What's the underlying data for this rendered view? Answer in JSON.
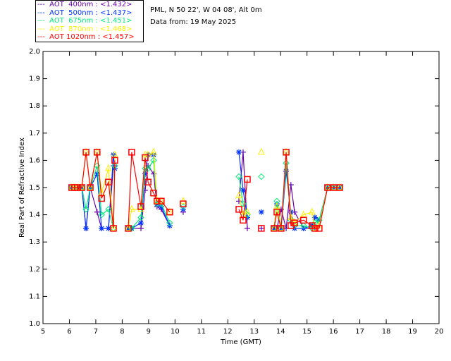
{
  "info": {
    "site": "PML, N 50 22', W 04 08', Alt 0m",
    "date": "Data from: 19 May 2025"
  },
  "chart_data": {
    "type": "line",
    "title": "",
    "xlabel": "Time (GMT)",
    "ylabel": "Real Part of Refractive Index",
    "xlim": [
      5,
      20
    ],
    "ylim": [
      1.0,
      2.0
    ],
    "xticks": [
      "5",
      "6",
      "7",
      "8",
      "9",
      "10",
      "11",
      "12",
      "13",
      "14",
      "15",
      "16",
      "17",
      "18",
      "19",
      "20"
    ],
    "yticks": [
      "1.0",
      "1.1",
      "1.2",
      "1.3",
      "1.4",
      "1.5",
      "1.6",
      "1.7",
      "1.8",
      "1.9",
      "2.0"
    ],
    "grid": false,
    "legend_position": "top-left, outside",
    "x": [
      6.09,
      6.2,
      6.31,
      6.47,
      6.63,
      6.79,
      7.05,
      7.22,
      7.48,
      7.67,
      7.72,
      8.23,
      8.36,
      8.71,
      8.87,
      8.98,
      9.19,
      9.32,
      9.48,
      9.8,
      10.31,
      12.42,
      12.58,
      12.74,
      13.27,
      13.75,
      13.86,
      14.02,
      14.21,
      14.39,
      14.53,
      14.87,
      15.19,
      15.3,
      15.46,
      15.78,
      16.02,
      16.24
    ],
    "series": [
      {
        "name": "AOT  400nm : <1.432>",
        "label": "---  AOT  400nm : <1.432>",
        "color": "#6600aa",
        "marker": "plus",
        "values": [
          1.5,
          1.5,
          1.5,
          1.5,
          1.35,
          1.5,
          1.41,
          1.35,
          1.35,
          1.58,
          1.58,
          1.35,
          1.35,
          1.35,
          1.49,
          1.58,
          1.55,
          1.43,
          1.42,
          1.36,
          1.41,
          1.45,
          1.63,
          1.35,
          1.35,
          1.35,
          1.35,
          1.42,
          1.35,
          1.51,
          1.41,
          1.35,
          1.35,
          1.35,
          1.36,
          1.5,
          1.5,
          1.5
        ]
      },
      {
        "name": "AOT  500nm : <1.437>",
        "label": "---  AOT  500nm : <1.437>",
        "color": "#0033ff",
        "marker": "asterisk",
        "values": [
          1.5,
          1.5,
          1.5,
          1.5,
          1.35,
          1.5,
          1.55,
          1.35,
          1.35,
          1.62,
          1.57,
          1.35,
          1.35,
          1.37,
          1.55,
          1.62,
          1.62,
          1.44,
          1.43,
          1.36,
          1.42,
          1.63,
          1.49,
          1.39,
          1.41,
          1.35,
          1.44,
          1.35,
          1.56,
          1.41,
          1.35,
          1.35,
          1.36,
          1.39,
          1.38,
          1.5,
          1.5,
          1.5
        ]
      },
      {
        "name": "AOT  675nm : <1.451>",
        "label": "---  AOT  675nm : <1.451>",
        "color": "#00ee77",
        "marker": "diamond",
        "values": [
          1.5,
          1.5,
          1.5,
          1.5,
          1.42,
          1.5,
          1.58,
          1.4,
          1.42,
          1.35,
          1.58,
          1.35,
          1.35,
          1.39,
          1.57,
          1.57,
          1.6,
          1.44,
          1.44,
          1.37,
          1.43,
          1.54,
          1.44,
          1.4,
          1.54,
          1.35,
          1.45,
          1.35,
          1.59,
          1.38,
          1.36,
          1.36,
          1.35,
          1.37,
          1.38,
          1.5,
          1.5,
          1.5
        ]
      },
      {
        "name": "AOT  870nm : <1.468>",
        "label": "---  AOT  870nm : <1.468>",
        "color": "#ffee00",
        "marker": "triangle",
        "values": [
          1.5,
          1.5,
          1.5,
          1.5,
          1.63,
          1.5,
          1.63,
          1.48,
          1.57,
          1.35,
          1.62,
          1.35,
          1.42,
          1.42,
          1.62,
          1.62,
          1.63,
          1.45,
          1.45,
          1.41,
          1.45,
          1.47,
          1.4,
          1.41,
          1.63,
          1.35,
          1.43,
          1.35,
          1.63,
          1.39,
          1.37,
          1.4,
          1.41,
          1.35,
          1.36,
          1.5,
          1.5,
          1.5
        ]
      },
      {
        "name": "AOT 1020nm : <1.457>",
        "label": "---  AOT 1020nm : <1.457>",
        "color": "#ff0000",
        "marker": "square",
        "values": [
          1.5,
          1.5,
          1.5,
          1.5,
          1.63,
          1.5,
          1.63,
          1.46,
          1.52,
          1.35,
          1.6,
          1.35,
          1.63,
          1.43,
          1.61,
          1.52,
          1.48,
          1.45,
          1.45,
          1.41,
          1.44,
          1.42,
          1.38,
          1.53,
          1.35,
          1.35,
          1.41,
          1.35,
          1.63,
          1.36,
          1.37,
          1.38,
          1.36,
          1.35,
          1.35,
          1.5,
          1.5,
          1.5
        ]
      }
    ]
  }
}
